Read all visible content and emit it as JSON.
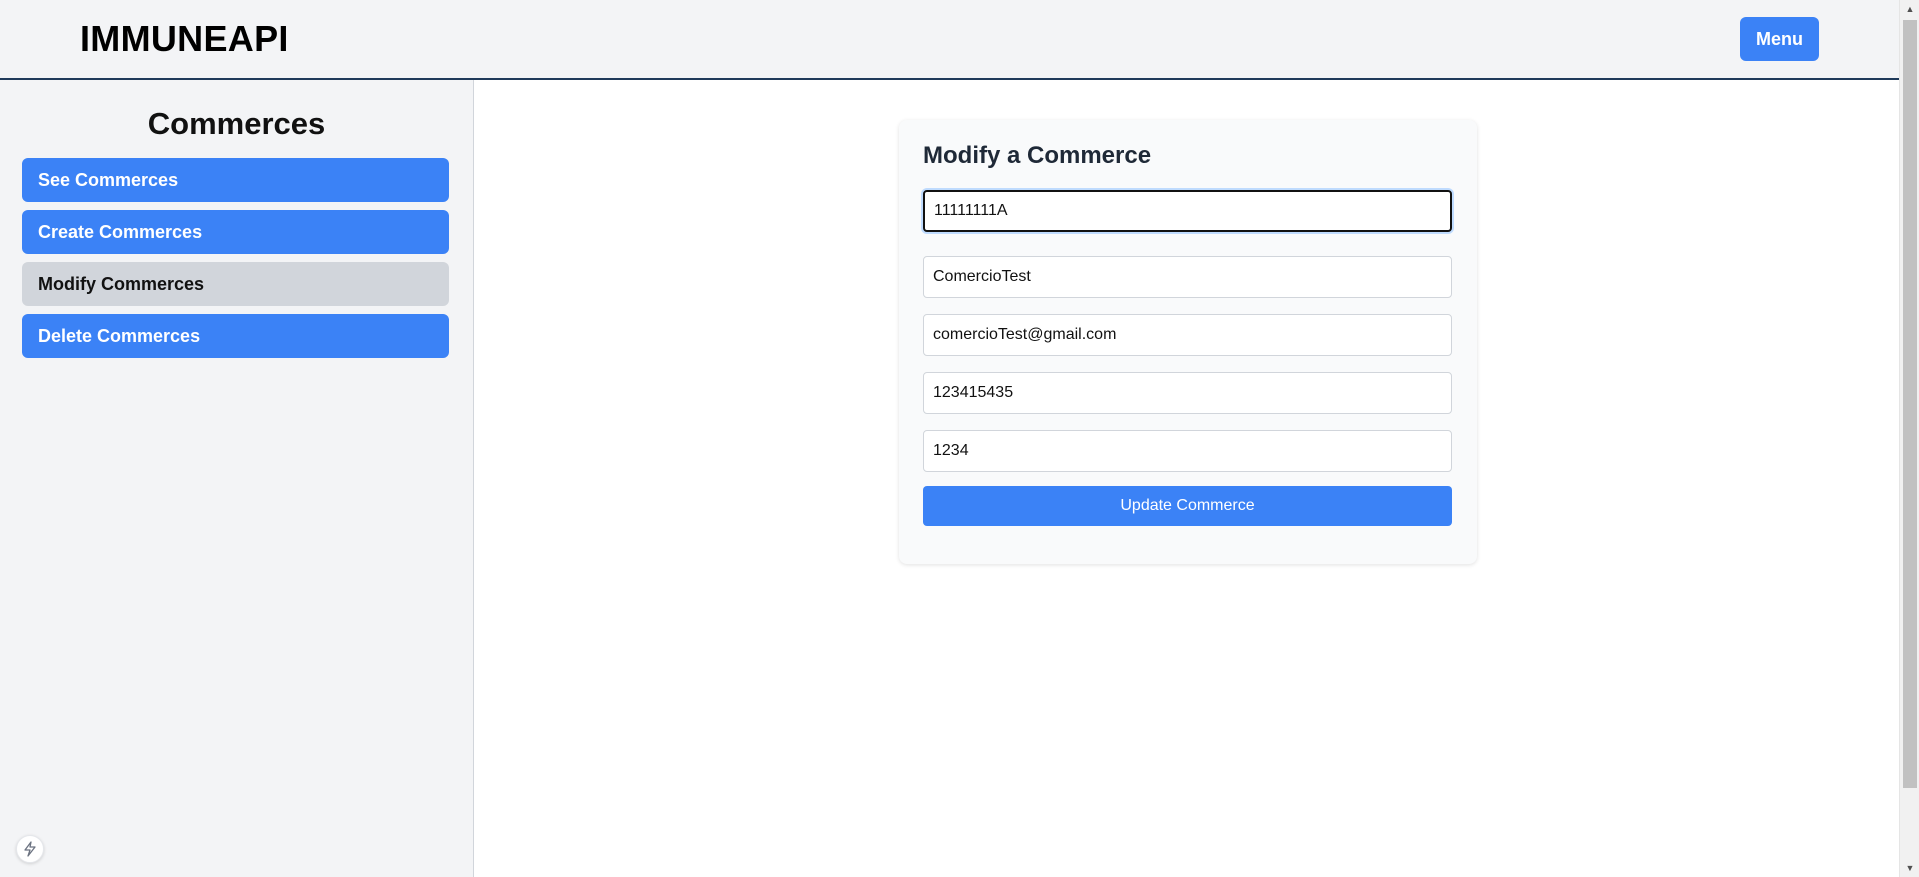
{
  "header": {
    "brand": "IMMUNEAPI",
    "menu_label": "Menu"
  },
  "sidebar": {
    "title": "Commerces",
    "items": [
      {
        "label": "See Commerces",
        "active": false
      },
      {
        "label": "Create Commerces",
        "active": false
      },
      {
        "label": "Modify Commerces",
        "active": true
      },
      {
        "label": "Delete Commerces",
        "active": false
      }
    ]
  },
  "form": {
    "title": "Modify a Commerce",
    "fields": [
      {
        "value": "11111111A",
        "focused": true
      },
      {
        "value": "ComercioTest",
        "focused": false
      },
      {
        "value": "comercioTest@gmail.com",
        "focused": false
      },
      {
        "value": "123415435",
        "focused": false
      },
      {
        "value": "1234",
        "focused": false
      }
    ],
    "submit_label": "Update Commerce"
  },
  "icons": {
    "bolt": "lightning-bolt-icon"
  },
  "colors": {
    "primary": "#3b82f6",
    "active_nav": "#d1d5db",
    "header_bg": "#f3f4f6",
    "header_border": "#1f3a5a"
  }
}
